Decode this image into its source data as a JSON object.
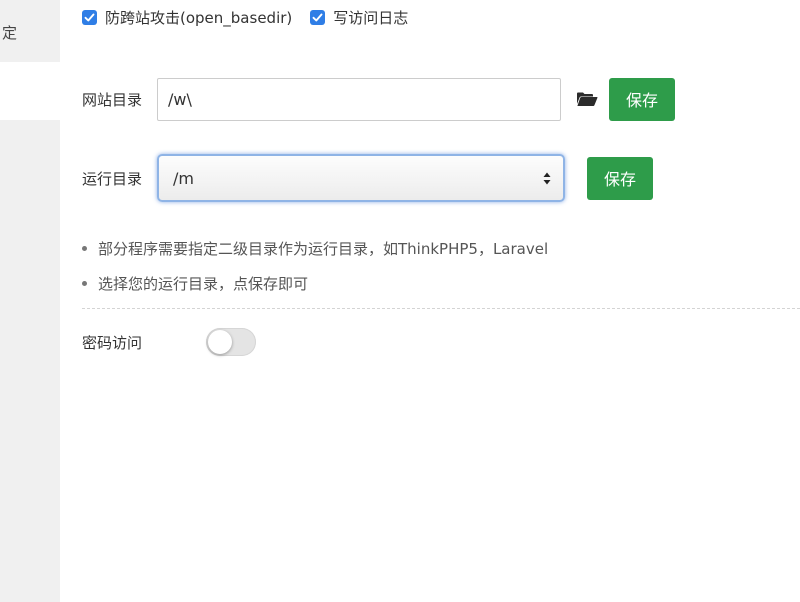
{
  "sidebar": {
    "items": [
      {
        "label": "定"
      },
      {
        "label": ""
      }
    ]
  },
  "options": {
    "open_basedir_label": "防跨站攻击(open_basedir)",
    "open_basedir_checked": true,
    "write_log_label": "写访问日志",
    "write_log_checked": true
  },
  "site_dir": {
    "label": "网站目录",
    "value": "/w\\",
    "icon": "folder-open-icon",
    "save_label": "保存"
  },
  "run_dir": {
    "label": "运行目录",
    "selected": "/m",
    "save_label": "保存"
  },
  "notes": [
    "部分程序需要指定二级目录作为运行目录，如ThinkPHP5，Laravel",
    "选择您的运行目录，点保存即可"
  ],
  "password_access": {
    "label": "密码访问",
    "enabled": false
  },
  "colors": {
    "accent_green": "#2e9c4a",
    "checkbox_blue": "#2f7ee6"
  }
}
